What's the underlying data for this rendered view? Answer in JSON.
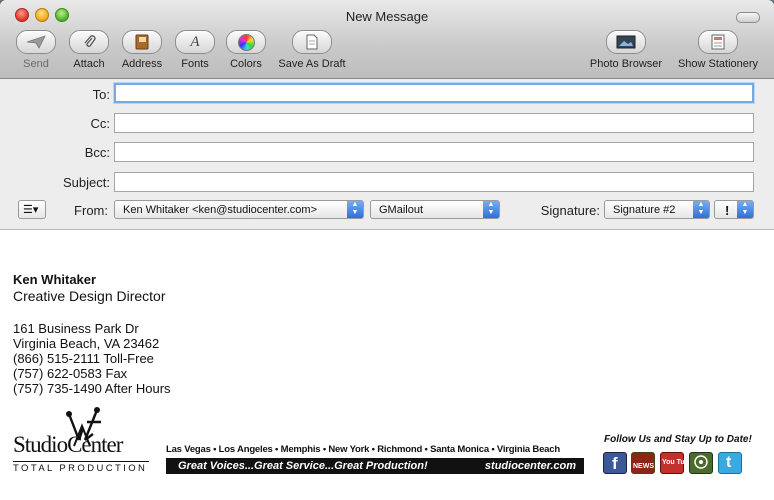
{
  "window": {
    "title": "New Message"
  },
  "toolbar": {
    "send_label": "Send",
    "attach_label": "Attach",
    "address_label": "Address",
    "fonts_label": "Fonts",
    "colors_label": "Colors",
    "save_draft_label": "Save As Draft",
    "photo_browser_label": "Photo Browser",
    "show_stationery_label": "Show Stationery"
  },
  "fields": {
    "to_label": "To:",
    "to_value": "",
    "cc_label": "Cc:",
    "cc_value": "",
    "bcc_label": "Bcc:",
    "bcc_value": "",
    "subject_label": "Subject:",
    "subject_value": ""
  },
  "from": {
    "label": "From:",
    "account": "Ken Whitaker <ken@studiocenter.com>",
    "server": "GMailout"
  },
  "signature": {
    "label": "Signature:",
    "selected": "Signature #2",
    "priority": "!"
  },
  "body": {
    "name": "Ken Whitaker",
    "title": "Creative Design Director",
    "address_line1": "161 Business Park Dr",
    "address_line2": "Virginia Beach, VA 23462",
    "phone_tollfree": "(866) 515-2111 Toll-Free",
    "phone_fax": "(757) 622-0583  Fax",
    "phone_after_hours": "(757) 735-1490 After Hours",
    "logo_name": "StudioCenter",
    "logo_tagline": "TOTAL PRODUCTION",
    "cities": "Las Vegas • Los Angeles • Memphis • New York • Richmond • Santa Monica • Virginia Beach",
    "slogan": "Great Voices...Great Service...Great Production!",
    "website": "studiocenter.com",
    "follow_text": "Follow Us and Stay Up to Date!",
    "social_news": "NEWS",
    "social_youtube": "You Tube"
  },
  "colors": {
    "focus_ring": "#7aa7df",
    "select_arrow": "#2f6fd7",
    "facebook": "#3b5998",
    "twitter": "#39a9e0"
  }
}
